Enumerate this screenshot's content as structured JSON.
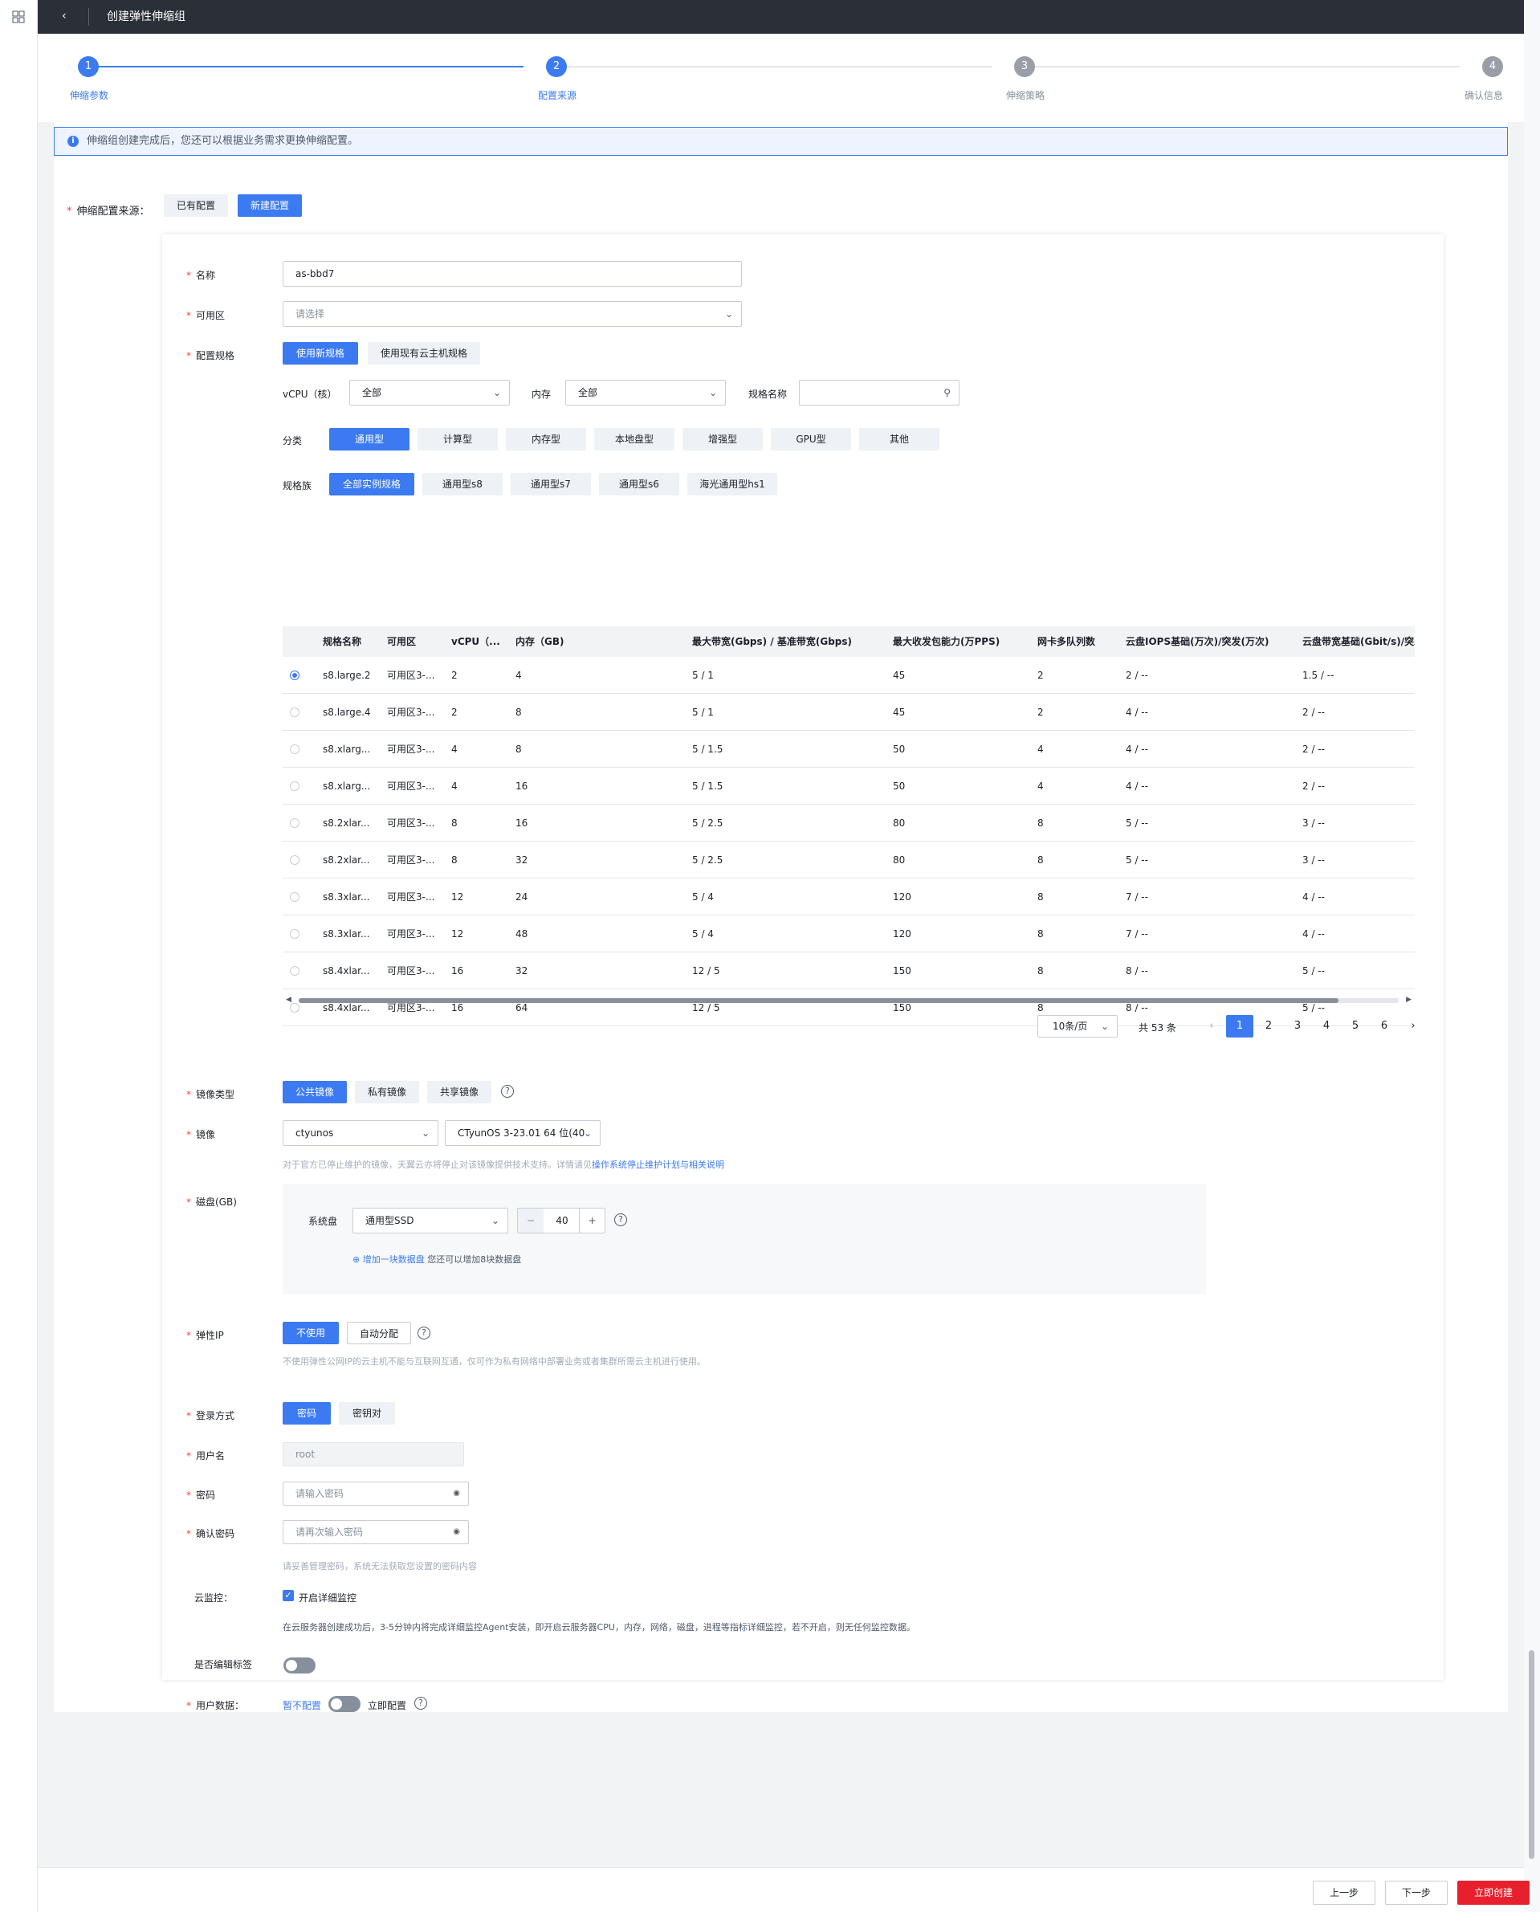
{
  "header": {
    "title": "创建弹性伸缩组"
  },
  "steps": [
    {
      "num": "1",
      "label": "伸缩参数",
      "state": "active"
    },
    {
      "num": "2",
      "label": "配置来源",
      "state": "active"
    },
    {
      "num": "3",
      "label": "伸缩策略",
      "state": "inactive"
    },
    {
      "num": "4",
      "label": "确认信息",
      "state": "inactive"
    }
  ],
  "notice": "伸缩组创建完成后，您还可以根据业务需求更换伸缩配置。",
  "source": {
    "label": "伸缩配置来源：",
    "existing": "已有配置",
    "new": "新建配置"
  },
  "form": {
    "name_label": "名称",
    "name_value": "as-bbd7",
    "zone_label": "可用区",
    "zone_placeholder": "请选择",
    "spec_label": "配置规格",
    "spec_new": "使用新规格",
    "spec_existing": "使用现有云主机规格",
    "vcpu_label": "vCPU（核）",
    "vcpu_value": "全部",
    "mem_label": "内存",
    "mem_value": "全部",
    "specname_label": "规格名称",
    "category_label": "分类",
    "categories": [
      "通用型",
      "计算型",
      "内存型",
      "本地盘型",
      "增强型",
      "GPU型",
      "其他"
    ],
    "family_label": "规格族",
    "families": [
      "全部实例规格",
      "通用型s8",
      "通用型s7",
      "通用型s6",
      "海光通用型hs1"
    ]
  },
  "table": {
    "headers": [
      "规格名称",
      "可用区",
      "vCPU（...",
      "内存（GB)",
      "最大带宽(Gbps) / 基准带宽(Gbps)",
      "最大收发包能力(万PPS)",
      "网卡多队列数",
      "云盘IOPS基础(万次)/突发(万次)",
      "云盘带宽基础(Gbit/s)/突发"
    ],
    "rows": [
      [
        "s8.large.2",
        "可用区3-...",
        "2",
        "4",
        "5 / 1",
        "45",
        "2",
        "2 / --",
        "1.5 / --"
      ],
      [
        "s8.large.4",
        "可用区3-...",
        "2",
        "8",
        "5 / 1",
        "45",
        "2",
        "4 / --",
        "2 / --"
      ],
      [
        "s8.xlarg...",
        "可用区3-...",
        "4",
        "8",
        "5 / 1.5",
        "50",
        "4",
        "4 / --",
        "2 / --"
      ],
      [
        "s8.xlarg...",
        "可用区3-...",
        "4",
        "16",
        "5 / 1.5",
        "50",
        "4",
        "4 / --",
        "2 / --"
      ],
      [
        "s8.2xlar...",
        "可用区3-...",
        "8",
        "16",
        "5 / 2.5",
        "80",
        "8",
        "5 / --",
        "3 / --"
      ],
      [
        "s8.2xlar...",
        "可用区3-...",
        "8",
        "32",
        "5 / 2.5",
        "80",
        "8",
        "5 / --",
        "3 / --"
      ],
      [
        "s8.3xlar...",
        "可用区3-...",
        "12",
        "24",
        "5 / 4",
        "120",
        "8",
        "7 / --",
        "4 / --"
      ],
      [
        "s8.3xlar...",
        "可用区3-...",
        "12",
        "48",
        "5 / 4",
        "120",
        "8",
        "7 / --",
        "4 / --"
      ],
      [
        "s8.4xlar...",
        "可用区3-...",
        "16",
        "32",
        "12 / 5",
        "150",
        "8",
        "8 / --",
        "5 / --"
      ],
      [
        "s8.4xlar...",
        "可用区3-...",
        "16",
        "64",
        "12 / 5",
        "150",
        "8",
        "8 / --",
        "5 / --"
      ]
    ]
  },
  "pager": {
    "size": "10条/页",
    "total": "共 53 条",
    "pages": [
      "1",
      "2",
      "3",
      "4",
      "5",
      "6"
    ],
    "current": "1"
  },
  "image": {
    "type_label": "镜像类型",
    "types": [
      "公共镜像",
      "私有镜像",
      "共享镜像"
    ],
    "label": "镜像",
    "os": "ctyunos",
    "version": "CTyunOS 3-23.01 64 位(40",
    "note": "对于官方已停止维护的镜像，天翼云亦将停止对该镜像提供技术支持。详情请见",
    "note_link": "操作系统停止维护计划与相关说明"
  },
  "disk": {
    "label": "磁盘(GB)",
    "sys_label": "系统盘",
    "type": "通用型SSD",
    "size": "40",
    "minus": "−",
    "plus": "+",
    "add_link": "增加一块数据盘",
    "add_hint": "您还可以增加8块数据盘"
  },
  "eip": {
    "label": "弹性IP",
    "no": "不使用",
    "auto": "自动分配",
    "note": "不使用弹性公网IP的云主机不能与互联网互通，仅可作为私有网络中部署业务或者集群所需云主机进行使用。"
  },
  "login": {
    "label": "登录方式",
    "password": "密码",
    "keypair": "密钥对",
    "user_label": "用户名",
    "user_value": "root",
    "pwd_label": "密码",
    "pwd_placeholder": "请输入密码",
    "confirm_label": "确认密码",
    "confirm_placeholder": "请再次输入密码",
    "hint": "请妥善管理密码，系统无法获取您设置的密码内容"
  },
  "monitor": {
    "label": "云监控：",
    "check": "开启详细监控",
    "note": "在云服务器创建成功后，3-5分钟内将完成详细监控Agent安装，即开启云服务器CPU，内存，网络，磁盘，进程等指标详细监控，若不开启，则无任何监控数据。"
  },
  "tags": {
    "label": "是否编辑标签"
  },
  "userdata": {
    "label": "用户数据：",
    "off": "暂不配置",
    "on": "立即配置"
  },
  "footer": {
    "prev": "上一步",
    "next": "下一步",
    "create": "立即创建"
  },
  "colors": {
    "primary": "#3b7af0",
    "danger": "#e8202d",
    "topbar": "#2b2f38"
  }
}
